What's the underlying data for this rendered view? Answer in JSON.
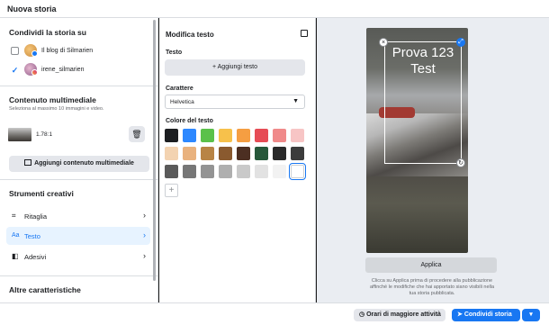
{
  "window": {
    "title": "Nuova storia"
  },
  "share": {
    "title": "Condividi la storia su",
    "accounts": [
      {
        "label": "Il blog di Silmarien",
        "checked": false
      },
      {
        "label": "irene_silmarien",
        "checked": true
      }
    ]
  },
  "media": {
    "title": "Contenuto multimediale",
    "hint": "Seleziona al massimo 10 immagini e video.",
    "ratio": "1.78:1",
    "add_button": "Aggiungi contenuto multimediale"
  },
  "tools": {
    "title": "Strumenti creativi",
    "items": [
      {
        "icon": "crop-icon",
        "label": "Ritaglia"
      },
      {
        "icon": "text-aa-icon",
        "label": "Testo",
        "selected": true
      },
      {
        "icon": "sticker-icon",
        "label": "Adesivi"
      }
    ]
  },
  "other": {
    "title": "Altre caratteristiche"
  },
  "edit": {
    "title": "Modifica testo",
    "text_label": "Testo",
    "add_text_button": "Aggiungi testo",
    "font_label": "Carattere",
    "font_value": "Helvetica",
    "color_label": "Colore del testo",
    "colors": [
      "#1c1e21",
      "#2d88ff",
      "#5bc14a",
      "#f7c14b",
      "#f59e42",
      "#e64c55",
      "#f08a8a",
      "#f7c5c5",
      "#f3d3b1",
      "#e9b27e",
      "#b88445",
      "#8a5a2f",
      "#4c2f22",
      "#27583a",
      "#2a2a2a",
      "#3c3c3c",
      "#5a5a5a",
      "#777777",
      "#939393",
      "#afafaf",
      "#c9c9c9",
      "#e2e2e2",
      "#f2f2f2",
      "#ffffff"
    ],
    "selected_color": "#ffffff"
  },
  "preview": {
    "story_text": "Prova 123 Test",
    "apply_button": "Applica",
    "note": "Clicca su Applica prima di procedere alla pubblicazione affinché le modifiche che hai apportato siano visibili nella tua storia pubblicata."
  },
  "footer": {
    "best_times_button": "Orari di maggiore attività",
    "share_button": "Condividi storia"
  }
}
